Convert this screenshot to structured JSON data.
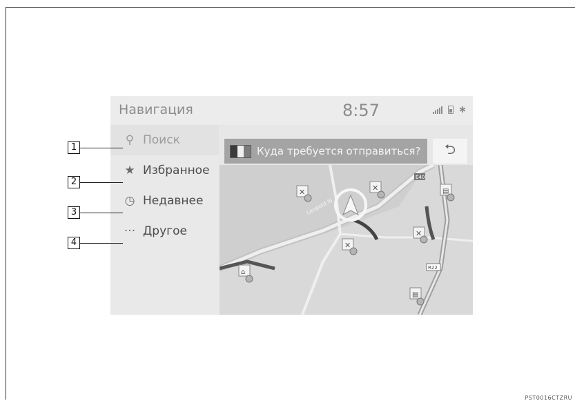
{
  "header": {
    "title": "Навигация",
    "time": "8:57"
  },
  "status_icons": [
    "signal-icon",
    "battery-icon",
    "bluetooth-icon"
  ],
  "menu": [
    {
      "icon": "search-icon",
      "glyph": "⚲",
      "label": "Поиск"
    },
    {
      "icon": "star-icon",
      "glyph": "★",
      "label": "Избранное"
    },
    {
      "icon": "clock-icon",
      "glyph": "◷",
      "label": "Недавнее"
    },
    {
      "icon": "more-icon",
      "glyph": "···",
      "label": "Другое"
    }
  ],
  "search": {
    "text": "Куда требуется отправиться?"
  },
  "back_glyph": "⮌",
  "callouts": [
    "1",
    "2",
    "3",
    "4"
  ],
  "map": {
    "street_label": "Leopold III",
    "road_labels": [
      "E40",
      "R22"
    ]
  },
  "footer_code": "PST0016CTZRU"
}
